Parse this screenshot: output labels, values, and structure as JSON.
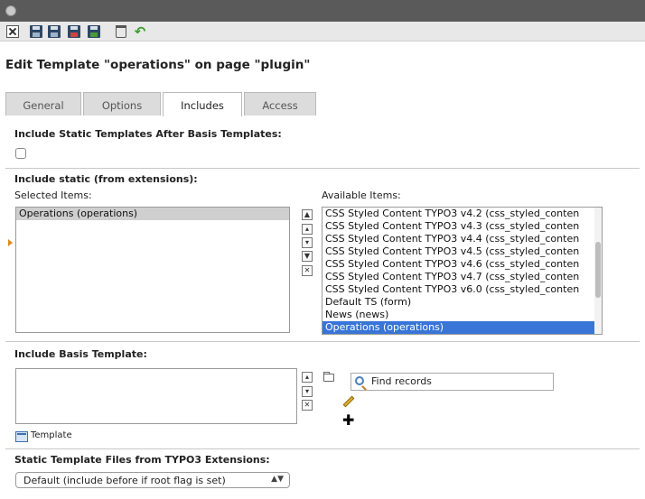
{
  "toolbar": {
    "icons": [
      "close-icon",
      "save-icon",
      "save-and-view-icon",
      "save-and-close-icon",
      "save-and-new-icon",
      "delete-icon",
      "undo-icon"
    ]
  },
  "page": {
    "title": "Edit Template \"operations\" on page \"plugin\""
  },
  "tabs": [
    {
      "label": "General",
      "active": false
    },
    {
      "label": "Options",
      "active": false
    },
    {
      "label": "Includes",
      "active": true
    },
    {
      "label": "Access",
      "active": false
    }
  ],
  "sections": {
    "static_after_basis": {
      "title": "Include Static Templates After Basis Templates:",
      "checked": false
    },
    "include_static": {
      "title": "Include static (from extensions):",
      "selected_label": "Selected Items:",
      "available_label": "Available Items:",
      "selected_items": [
        "Operations (operations)"
      ],
      "available_items": [
        "CSS Styled Content TYPO3 v4.2 (css_styled_conten",
        "CSS Styled Content TYPO3 v4.3 (css_styled_conten",
        "CSS Styled Content TYPO3 v4.4 (css_styled_conten",
        "CSS Styled Content TYPO3 v4.5 (css_styled_conten",
        "CSS Styled Content TYPO3 v4.6 (css_styled_conten",
        "CSS Styled Content TYPO3 v4.7 (css_styled_conten",
        "CSS Styled Content TYPO3 v6.0 (css_styled_conten",
        "Default TS (form)",
        "News (news)",
        "Operations (operations)"
      ],
      "available_selected_index": 9
    },
    "basis_template": {
      "title": "Include Basis Template:",
      "search_placeholder": "Find records",
      "template_link": "Template"
    },
    "static_files": {
      "title": "Static Template Files from TYPO3 Extensions:",
      "selected_option": "Default (include before if root flag is set)"
    }
  },
  "colors": {
    "topbar": "#5a5a5a",
    "selection_blue": "#3875d7",
    "marker_orange": "#e08a1e"
  }
}
